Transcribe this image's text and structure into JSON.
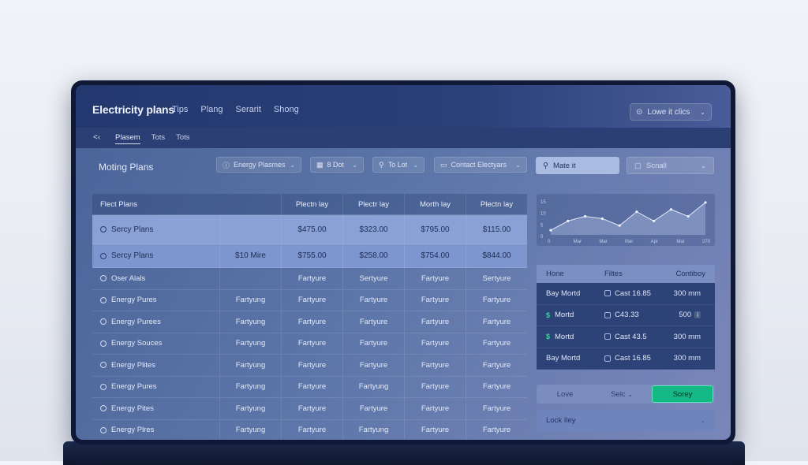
{
  "app": {
    "title": "Electricity plans"
  },
  "topnav": [
    "Tips",
    "Plang",
    "Serarit",
    "Shong"
  ],
  "top_search": {
    "label": "Lowe it clics"
  },
  "tabs": [
    "Plasem",
    "Tots",
    "Tots"
  ],
  "section_title": "Moting Plans",
  "filters": [
    {
      "label": "Energy Plasmes",
      "icon": "info-icon"
    },
    {
      "label": "8 Dot",
      "icon": "grid-icon"
    },
    {
      "label": "To Lot",
      "icon": "user-icon"
    },
    {
      "label": "Contact Electyars",
      "icon": "doc-icon"
    }
  ],
  "match_button": {
    "label": "Mate it"
  },
  "cancel_button": {
    "label": "Scnall"
  },
  "table": {
    "headers": [
      "Flect Plans",
      "Plectn lay",
      "Plectr lay",
      "Morth lay",
      "Plectn lay"
    ],
    "rows": [
      [
        "Sercy Plans",
        "",
        "$475.00",
        "$323.00",
        "$795.00",
        "$115.00"
      ],
      [
        "Sercy Plans",
        "$10 Mire",
        "$755.00",
        "$258.00",
        "$754.00",
        "$844.00"
      ],
      [
        "Oser Alals",
        "",
        "Fartyure",
        "Sertyure",
        "Fartyure",
        "Sertyure"
      ],
      [
        "Energy Pures",
        "Fartyung",
        "Fartyure",
        "Fartyure",
        "Fartyure",
        "Fartyure"
      ],
      [
        "Energy Purees",
        "Fartyung",
        "Fartyure",
        "Fartyure",
        "Fartyure",
        "Fartyure"
      ],
      [
        "Energy Souces",
        "Fartyung",
        "Fartyure",
        "Fartyure",
        "Fartyure",
        "Fartyure"
      ],
      [
        "Energy Plites",
        "Fartyung",
        "Fartyure",
        "Fartyure",
        "Fartyure",
        "Fartyure"
      ],
      [
        "Energy Pures",
        "Fartyung",
        "Fartyure",
        "Fartyung",
        "Fartyure",
        "Fartyure"
      ],
      [
        "Energy Pites",
        "Fartyung",
        "Fartyure",
        "Fartyure",
        "Fartyure",
        "Fartyure"
      ],
      [
        "Energy Plres",
        "Fartyung",
        "Fartyure",
        "Fartyung",
        "Fartyure",
        "Fartyure"
      ]
    ]
  },
  "mini_chart": {
    "y_ticks": [
      "15",
      "10",
      "5",
      "0"
    ],
    "x_ticks": [
      "0",
      "Mar",
      "Mar",
      "Mar",
      "Apr",
      "Mar",
      "270"
    ],
    "values": [
      2,
      6,
      8,
      7,
      4,
      10,
      6,
      11,
      8,
      14
    ]
  },
  "right_table": {
    "headers": [
      "Hone",
      "Filtes",
      "Contiboy"
    ],
    "rows": [
      {
        "prefix": "",
        "name": "Bay Mortd",
        "icon": "box",
        "cost": "Cast 16.85",
        "value": "300 mm",
        "tag": ""
      },
      {
        "prefix": "$",
        "name": "Mortd",
        "icon": "box",
        "cost": "C43.33",
        "value": "500",
        "tag": "i"
      },
      {
        "prefix": "$",
        "name": "Mortd",
        "icon": "box",
        "cost": "Cast 43.5",
        "value": "300 mm",
        "tag": ""
      },
      {
        "prefix": "",
        "name": "Bay Mortd",
        "icon": "box",
        "cost": "Cast 16.85",
        "value": "300 mm",
        "tag": ""
      }
    ]
  },
  "action_bar": {
    "a1": "Love",
    "a2": "Selc",
    "a3": "Sorey"
  },
  "lock_bar": {
    "label": "Lock Iley"
  },
  "colors": {
    "accent": "#14b884",
    "topbar": "#23386e",
    "highlight": "#8aa1d6"
  }
}
